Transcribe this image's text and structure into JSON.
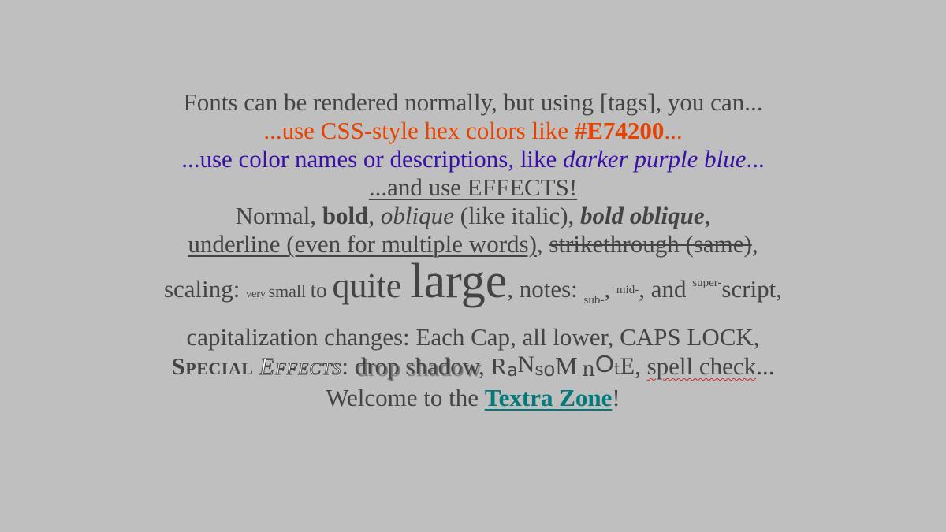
{
  "colors": {
    "background": "#bfbfbf",
    "text": "#444444",
    "hex_orange": "#E74200",
    "purple_blue": "#3a10a8",
    "link_teal": "#007a7a",
    "spell_red": "#d4242a"
  },
  "lines": {
    "l1": "Fonts can be rendered normally, but using [tags], you can...",
    "l2_pre": "...use CSS-style hex colors like ",
    "l2_hex": "#E74200",
    "l2_post": "...",
    "l3_pre": "...use color names or descriptions, like ",
    "l3_ital": "darker purple blue",
    "l3_post": "...",
    "l4": "...and use EFFECTS!",
    "l5_normal": "Normal, ",
    "l5_bold": "bold",
    "l5_c1": ", ",
    "l5_oblique": "oblique",
    "l5_like": " (like italic), ",
    "l5_bolob": "bold oblique",
    "l5_end": ",",
    "l6_under": "underline (even for multiple words)",
    "l6_c": ", ",
    "l6_strike": "strikethrough (same)",
    "l6_end": ",",
    "l7_scaling": "scaling: ",
    "l7_very": "very ",
    "l7_small": "small ",
    "l7_to": "to ",
    "l7_quite": "quite ",
    "l7_large": "large",
    "l7_notes": ", notes: ",
    "l7_sub": "sub-",
    "l7_c": ", ",
    "l7_midn": "mid-",
    "l7_and": ", and ",
    "l7_sup": "super-",
    "l7_script": "script,",
    "l8": "capitalization changes: Each Cap, all lower, CAPS LOCK,",
    "l9_special": "Special",
    "l9_effects": "Effects",
    "l9_colon": ": ",
    "l9_shadow": "drop shadow",
    "l9_c": ", ",
    "l9_ransom": [
      "R",
      "a",
      "N",
      "s",
      "o",
      "M",
      " ",
      "n",
      "O",
      "t",
      "E"
    ],
    "l9_c2": ", ",
    "l9_spell": "spell check",
    "l9_end": "...",
    "l10_pre": "Welcome to the ",
    "l10_link": "Textra Zone",
    "l10_end": "!"
  }
}
